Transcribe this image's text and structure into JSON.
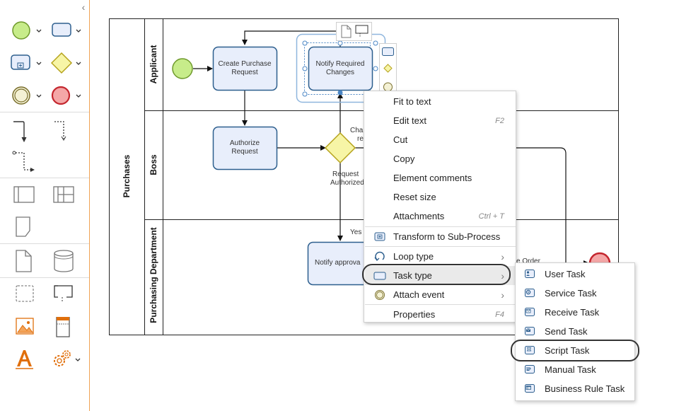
{
  "palette": {
    "collapse_glyph": "‹"
  },
  "pool": {
    "name": "Purchases",
    "lanes": [
      "Applicant",
      "Boss",
      "Purchasing Department"
    ]
  },
  "tasks": {
    "create_purchase_request": "Create Purchase Request",
    "notify_required_changes": "Notify Required Changes",
    "authorize_request": "Authorize Request",
    "notify_approval": "Notify approva",
    "purchase_order_partial": "e Order"
  },
  "edge_labels": {
    "changes_partial_1": "Cha",
    "changes_partial_2": "re",
    "request_authorized_1": "Request",
    "request_authorized_2": "Authorized",
    "yes": "Yes"
  },
  "context_menu": {
    "items": [
      {
        "label": "Fit to text",
        "shortcut": ""
      },
      {
        "label": "Edit text",
        "shortcut": "F2"
      },
      {
        "label": "Cut",
        "shortcut": ""
      },
      {
        "label": "Copy",
        "shortcut": ""
      },
      {
        "label": "Element comments",
        "shortcut": ""
      },
      {
        "label": "Reset size",
        "shortcut": ""
      },
      {
        "label": "Attachments",
        "shortcut": "Ctrl + T"
      },
      {
        "label": "Transform to Sub-Process",
        "shortcut": ""
      },
      {
        "label": "Loop type",
        "shortcut": ""
      },
      {
        "label": "Task type",
        "shortcut": ""
      },
      {
        "label": "Attach event",
        "shortcut": ""
      },
      {
        "label": "Properties",
        "shortcut": "F4"
      }
    ],
    "arrow_glyph": "›"
  },
  "task_type_submenu": {
    "items": [
      {
        "label": "User Task"
      },
      {
        "label": "Service Task"
      },
      {
        "label": "Receive Task"
      },
      {
        "label": "Send Task"
      },
      {
        "label": "Script Task"
      },
      {
        "label": "Manual Task"
      },
      {
        "label": "Business Rule Task"
      }
    ]
  },
  "colors": {
    "task_fill": "#e8eefb",
    "task_stroke": "#2d5f8e",
    "start_fill": "#c7ec8a",
    "start_stroke": "#6f9a2c",
    "end_fill": "#f4a7a7",
    "end_stroke": "#c4262e",
    "gateway_fill": "#f7f5a6",
    "gateway_stroke": "#b5a21b",
    "palette_border": "#f0a254",
    "selection": "#4a86c5"
  }
}
